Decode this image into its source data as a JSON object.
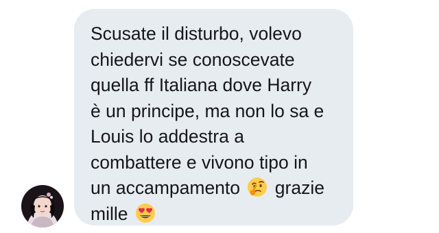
{
  "message": {
    "lines": [
      "Scusate il disturbo, volevo",
      "chiedervi se conoscevate",
      "quella ff Italiana dove Harry",
      "è un principe, ma non lo sa e",
      "Louis lo addestra a",
      "combattere e vivono tipo in"
    ],
    "line7_before": "un accampamento",
    "line7_after": "grazie",
    "line8_before": "mille"
  },
  "emojis": {
    "thinking": "thinking-face-icon",
    "heart_eyes": "heart-eyes-face-icon"
  },
  "colors": {
    "bubble_background": "#e6ecf0",
    "text": "#14171a",
    "page_background": "#ffffff"
  }
}
